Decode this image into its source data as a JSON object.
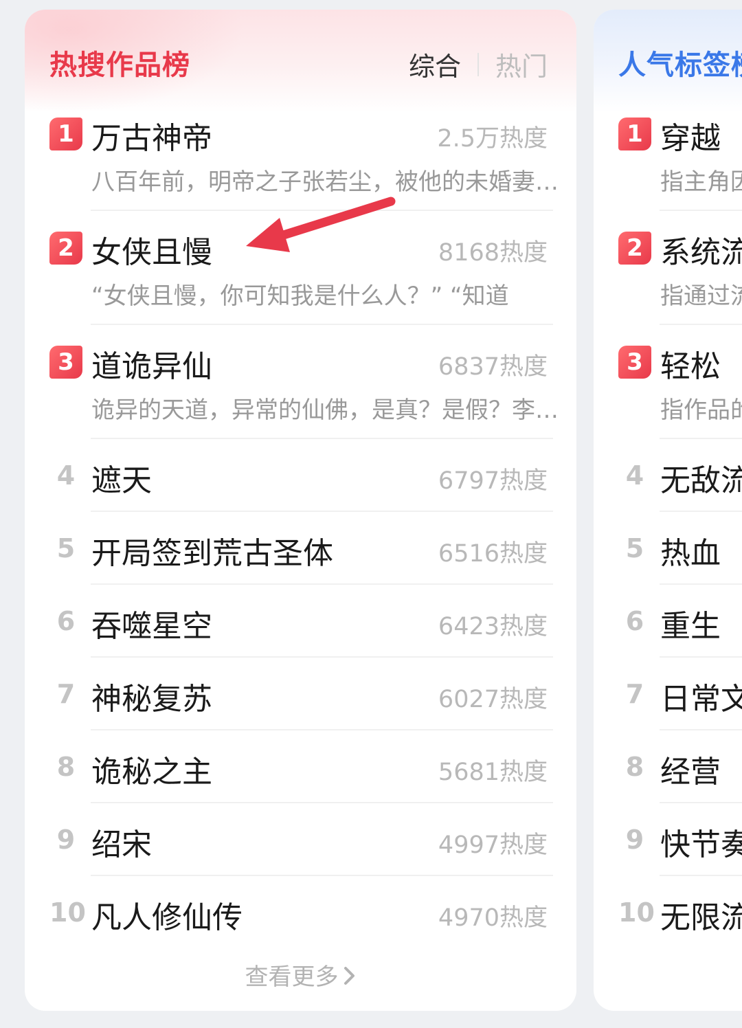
{
  "left_panel": {
    "title": "热搜作品榜",
    "tabs": [
      {
        "label": "综合",
        "active": true
      },
      {
        "label": "热门",
        "active": false
      }
    ],
    "items": [
      {
        "rank": "1",
        "title": "万古神帝",
        "heat": "2.5万热度",
        "desc": "八百年前，明帝之子张若尘，被他的未婚妻池瑶公主杀死"
      },
      {
        "rank": "2",
        "title": "女侠且慢",
        "heat": "8168热度",
        "desc": "“女侠且慢，你可知我是什么人？” “知道"
      },
      {
        "rank": "3",
        "title": "道诡异仙",
        "heat": "6837热度",
        "desc": "诡异的天道，异常的仙佛，是真？是假？李火旺"
      },
      {
        "rank": "4",
        "title": "遮天",
        "heat": "6797热度"
      },
      {
        "rank": "5",
        "title": "开局签到荒古圣体",
        "heat": "6516热度"
      },
      {
        "rank": "6",
        "title": "吞噬星空",
        "heat": "6423热度"
      },
      {
        "rank": "7",
        "title": "神秘复苏",
        "heat": "6027热度"
      },
      {
        "rank": "8",
        "title": "诡秘之主",
        "heat": "5681热度"
      },
      {
        "rank": "9",
        "title": "绍宋",
        "heat": "4997热度"
      },
      {
        "rank": "10",
        "title": "凡人修仙传",
        "heat": "4970热度"
      }
    ],
    "more_label": "查看更多"
  },
  "right_panel": {
    "title": "人气标签榜",
    "items": [
      {
        "rank": "1",
        "title": "穿越",
        "desc": "指主角因"
      },
      {
        "rank": "2",
        "title": "系统流",
        "desc": "指通过流"
      },
      {
        "rank": "3",
        "title": "轻松",
        "desc": "指作品的"
      },
      {
        "rank": "4",
        "title": "无敌流"
      },
      {
        "rank": "5",
        "title": "热血"
      },
      {
        "rank": "6",
        "title": "重生"
      },
      {
        "rank": "7",
        "title": "日常文"
      },
      {
        "rank": "8",
        "title": "经营"
      },
      {
        "rank": "9",
        "title": "快节奏"
      },
      {
        "rank": "10",
        "title": "无限流"
      }
    ]
  },
  "colors": {
    "accent_red": "#e8394a",
    "accent_blue": "#3a78e8",
    "annotation_arrow": "#e8394a"
  },
  "icons": {
    "more_chevron": "chevron-right-icon",
    "annotation": "red-arrow-icon"
  }
}
